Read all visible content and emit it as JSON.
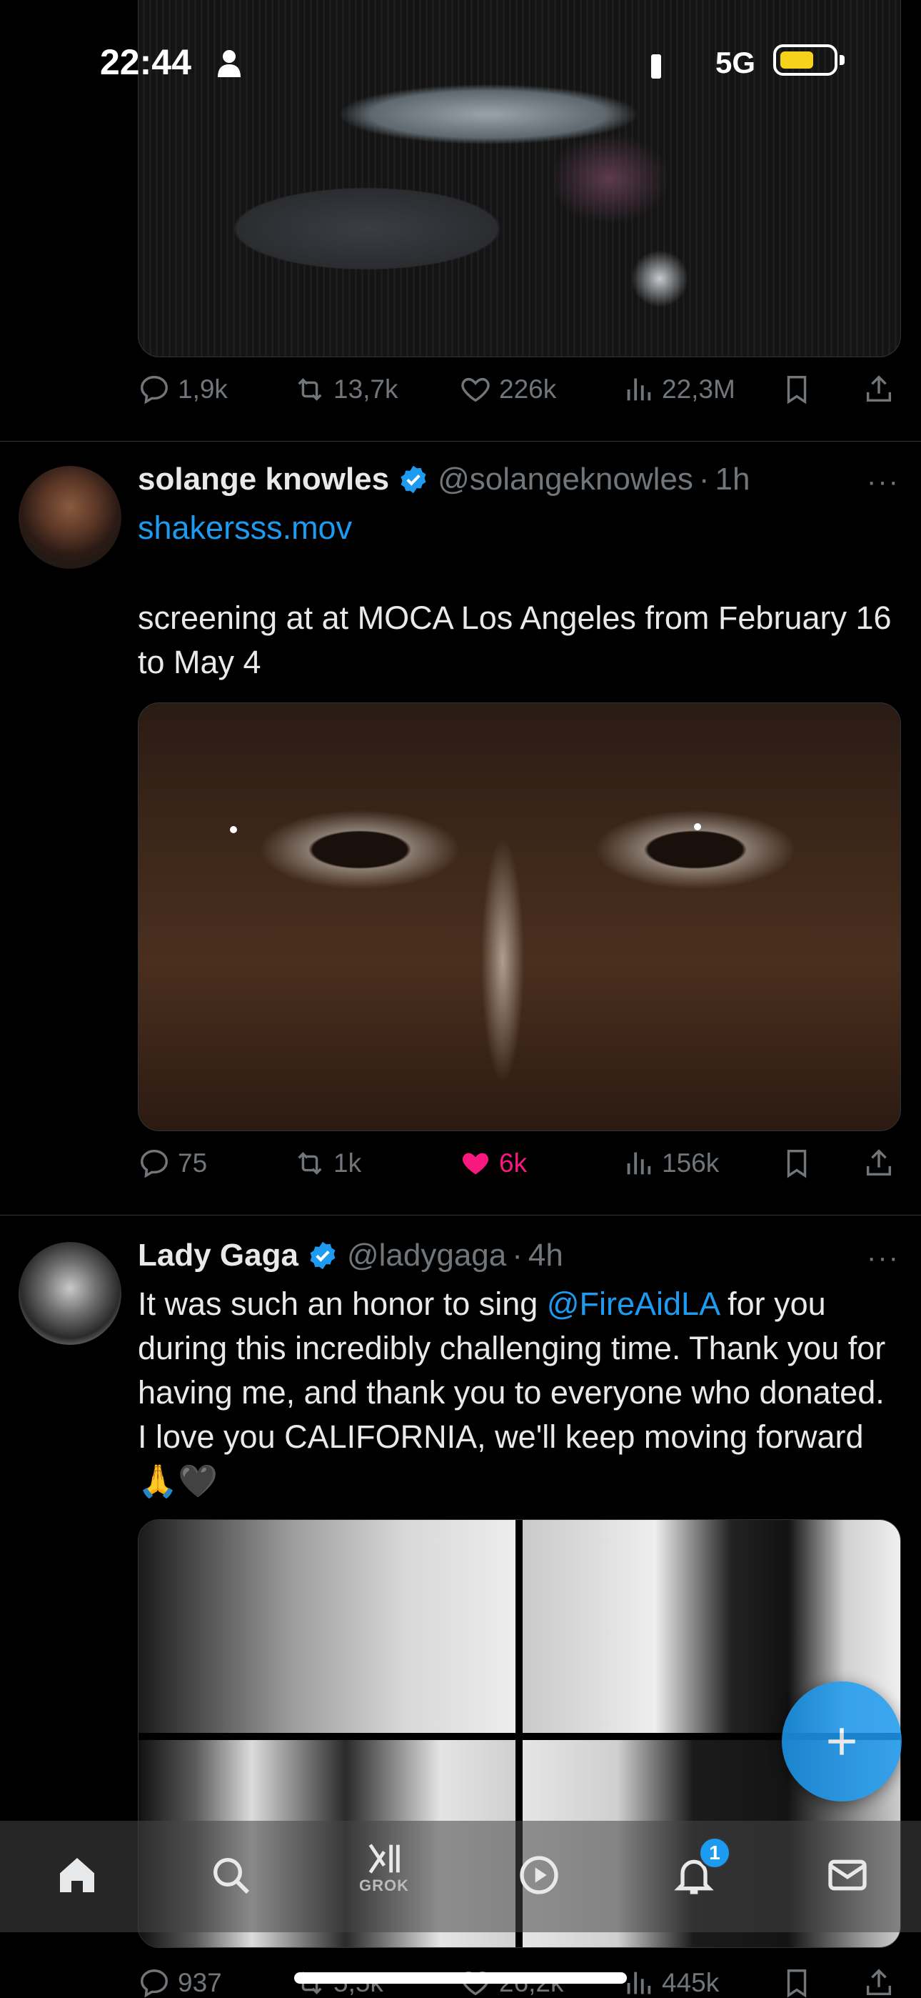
{
  "status_bar": {
    "time": "22:44",
    "network": "5G"
  },
  "tweets": [
    {
      "actions": {
        "replies": "1,9k",
        "retweets": "13,7k",
        "likes": "226k",
        "views": "22,3M"
      }
    },
    {
      "name": "solange knowles",
      "handle": "@solangeknowles",
      "separator": "·",
      "time": "1h",
      "more": "···",
      "link_text": "shakersss.mov",
      "text": "screening at at MOCA Los Angeles from February 16 to May 4",
      "actions": {
        "replies": "75",
        "retweets": "1k",
        "likes": "6k",
        "views": "156k"
      },
      "liked": true
    },
    {
      "name": "Lady Gaga",
      "handle": "@ladygaga",
      "separator": "·",
      "time": "4h",
      "more": "···",
      "text_before": "It was such an honor to sing ",
      "mention": "@FireAidLA",
      "text_after": " for you during this incredibly challenging time. Thank you for having me, and thank you to everyone who donated. I love you CALIFORNIA, we'll keep moving forward 🙏🖤",
      "actions": {
        "replies": "937",
        "retweets": "5,5k",
        "likes": "26,2k",
        "views": "445k"
      }
    }
  ],
  "bottom_nav": {
    "items": [
      {
        "icon": "home-icon"
      },
      {
        "icon": "search-icon"
      },
      {
        "icon": "grok-icon",
        "label": "GROK"
      },
      {
        "icon": "video-icon"
      },
      {
        "icon": "notifications-icon",
        "badge": "1"
      },
      {
        "icon": "mail-icon"
      }
    ]
  },
  "colors": {
    "accent": "#1d9bf0",
    "like": "#f91880",
    "muted": "#71767b",
    "background": "#000000"
  }
}
